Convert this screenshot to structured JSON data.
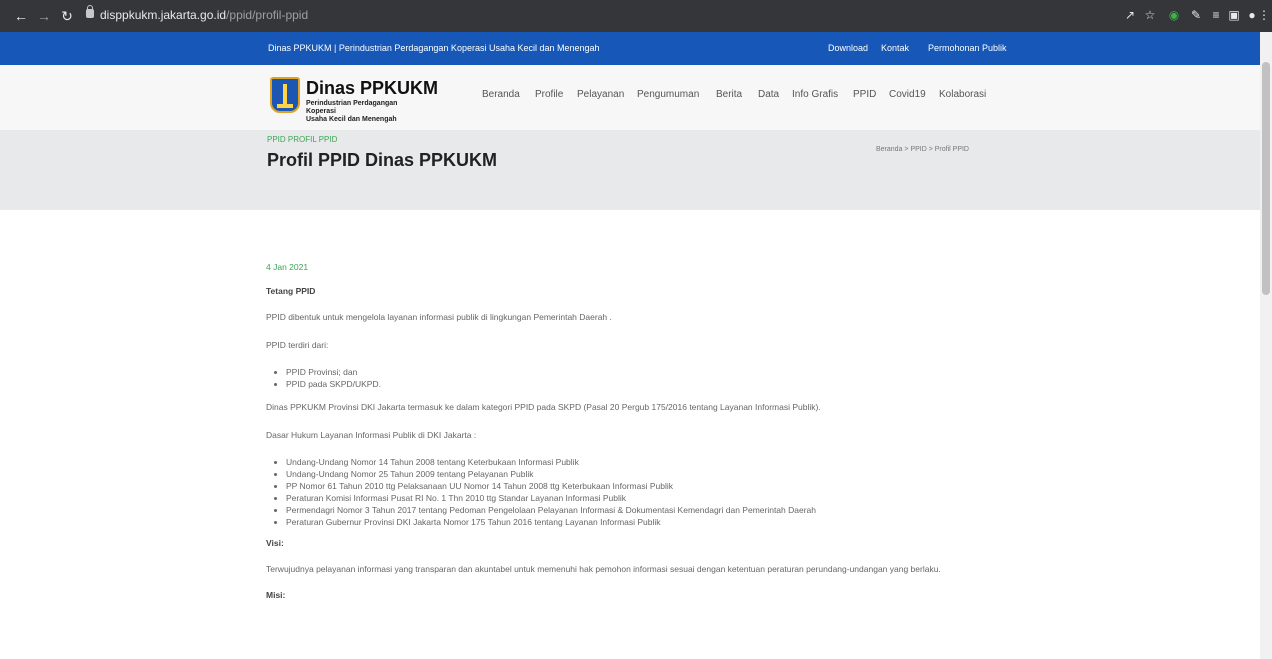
{
  "browser": {
    "url_host": "disppkukm.jakarta.go.id",
    "url_path": "/ppid/profil-ppid"
  },
  "topbar": {
    "tagline": "Dinas PPKUKM | Perindustrian Perdagangan Koperasi Usaha Kecil dan Menengah",
    "links": [
      "Download",
      "Kontak",
      "Permohonan Publik"
    ]
  },
  "header": {
    "brand_title": "Dinas PPKUKM",
    "brand_sub_1": "Perindustrian Perdagangan Koperasi",
    "brand_sub_2": "Usaha Kecil dan Menengah",
    "nav": [
      "Beranda",
      "Profile",
      "Pelayanan",
      "Pengumuman",
      "Berita",
      "Data",
      "Info Grafis",
      "PPID",
      "Covid19",
      "Kolaborasi"
    ]
  },
  "banner": {
    "crumb_top": "PPID PROFIL PPID",
    "title": "Profil PPID Dinas PPKUKM",
    "breadcrumb": "Beranda  >  PPID  >  Profil PPID"
  },
  "content": {
    "date": "4 Jan 2021",
    "heading_tentang": "Tetang PPID",
    "p1": "PPID dibentuk untuk mengelola layanan informasi publik di lingkungan Pemerintah Daerah .",
    "p2": "PPID terdiri dari:",
    "list1": [
      "PPID Provinsi; dan",
      "PPID pada SKPD/UKPD."
    ],
    "p3": "Dinas PPKUKM Provinsi DKI Jakarta termasuk ke dalam kategori PPID pada SKPD (Pasal 20 Pergub 175/2016 tentang Layanan Informasi Publik).",
    "p4": "Dasar Hukum Layanan Informasi Publik di DKI Jakarta :",
    "list2": [
      "Undang-Undang Nomor 14 Tahun 2008 tentang Keterbukaan Informasi Publik",
      "Undang-Undang Nomor 25 Tahun 2009 tentang Pelayanan Publik",
      "PP Nomor 61 Tahun 2010 ttg Pelaksanaan UU Nomor 14 Tahun 2008 ttg Keterbukaan Informasi Publik",
      "Peraturan Komisi Informasi Pusat RI No. 1 Thn 2010 ttg Standar Layanan Informasi Publik",
      "Permendagri Nomor 3 Tahun 2017 tentang Pedoman Pengelolaan Pelayanan Informasi & Dokumentasi Kemendagri dan Pemerintah Daerah",
      "Peraturan Gubernur  Provinsi DKI Jakarta Nomor 175 Tahun 2016 tentang Layanan Informasi Publik"
    ],
    "heading_visi": "Visi:",
    "p5": "Terwujudnya pelayanan informasi yang transparan dan akuntabel untuk memenuhi hak pemohon informasi sesuai dengan ketentuan peraturan perundang-undangan yang berlaku.",
    "heading_misi": "Misi:"
  }
}
